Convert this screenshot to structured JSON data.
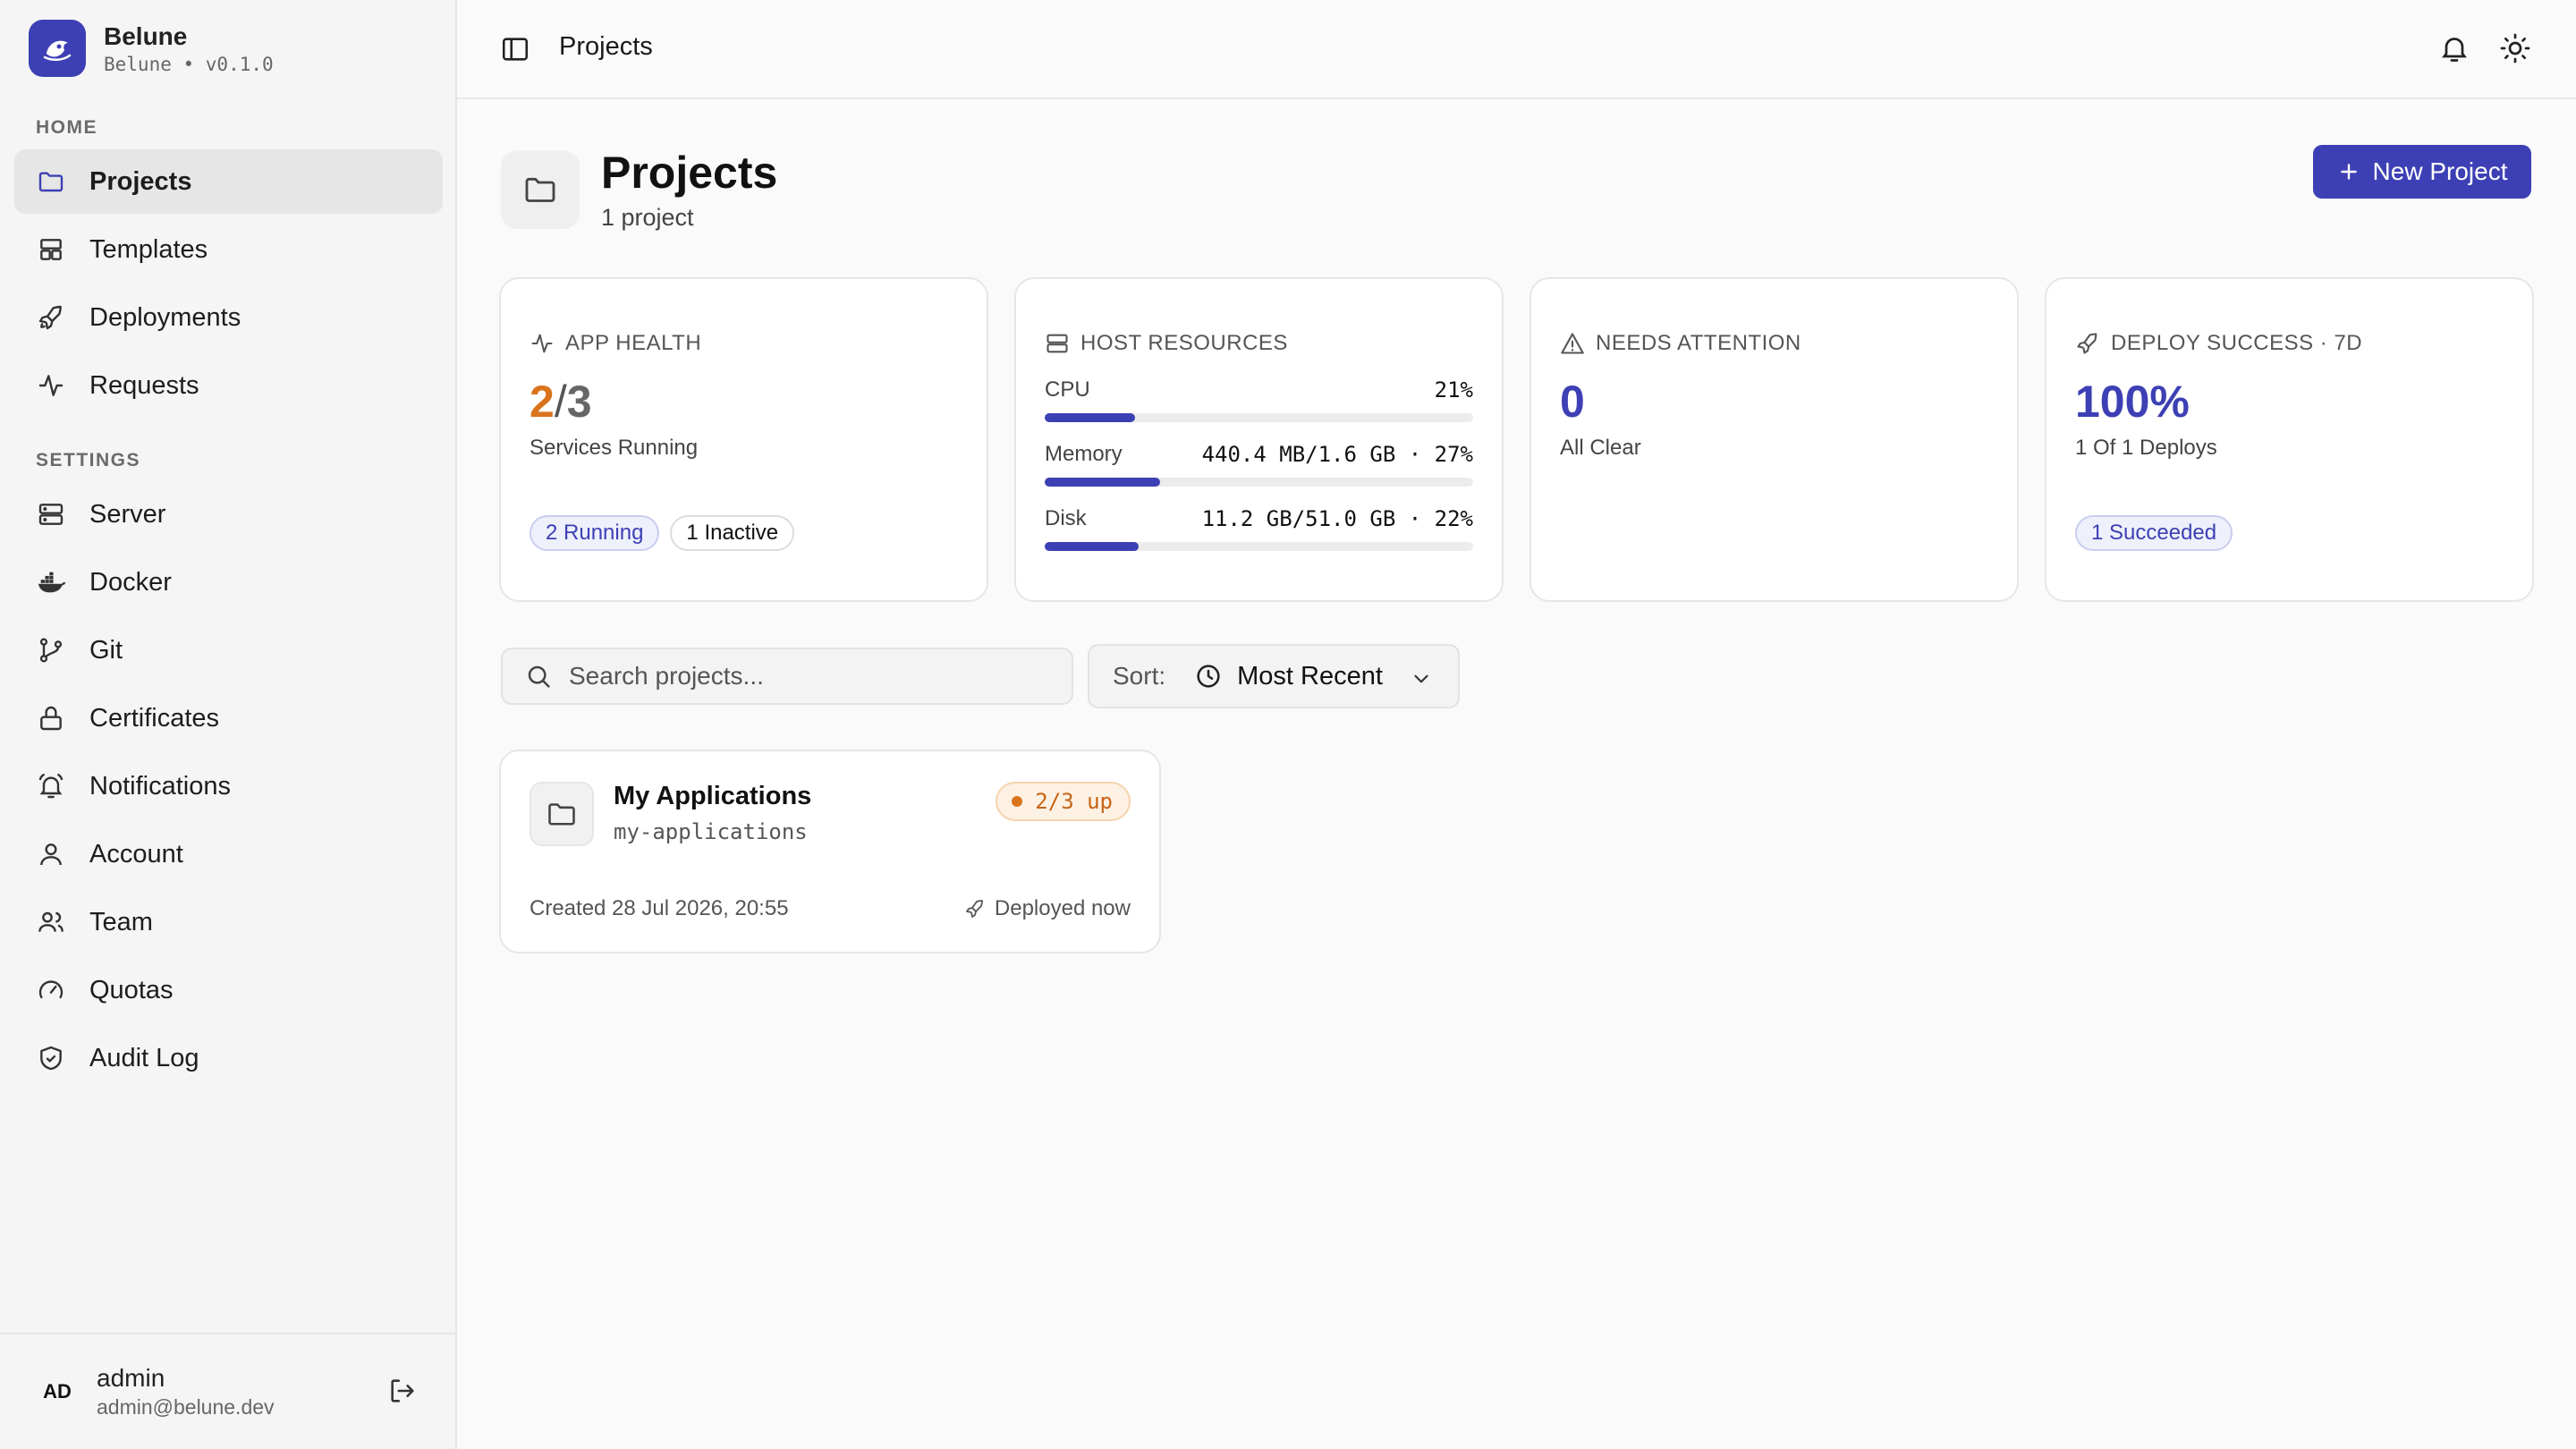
{
  "brand": {
    "name": "Belune",
    "version": "Belune • v0.1.0"
  },
  "sidebar": {
    "home_label": "HOME",
    "home_items": [
      {
        "label": "Projects",
        "icon": "folder-icon",
        "active": true
      },
      {
        "label": "Templates",
        "icon": "layout-icon"
      },
      {
        "label": "Deployments",
        "icon": "rocket-icon"
      },
      {
        "label": "Requests",
        "icon": "activity-icon"
      }
    ],
    "settings_label": "SETTINGS",
    "settings_items": [
      {
        "label": "Server",
        "icon": "server-icon"
      },
      {
        "label": "Docker",
        "icon": "docker-icon"
      },
      {
        "label": "Git",
        "icon": "git-branch-icon"
      },
      {
        "label": "Certificates",
        "icon": "lock-icon"
      },
      {
        "label": "Notifications",
        "icon": "bell-ring-icon"
      },
      {
        "label": "Account",
        "icon": "user-icon"
      },
      {
        "label": "Team",
        "icon": "users-icon"
      },
      {
        "label": "Quotas",
        "icon": "gauge-icon"
      },
      {
        "label": "Audit Log",
        "icon": "shield-check-icon"
      }
    ],
    "user": {
      "initials": "AD",
      "name": "admin",
      "email": "admin@belune.dev"
    }
  },
  "topbar": {
    "title": "Projects"
  },
  "page": {
    "title": "Projects",
    "subtitle": "1 project",
    "new_button": "New Project"
  },
  "cards": {
    "app_health": {
      "title": "APP HEALTH",
      "running": "2",
      "separator": "/",
      "total": "3",
      "sub": "Services Running",
      "pill_running": "2 Running",
      "pill_inactive": "1 Inactive"
    },
    "host_resources": {
      "title": "HOST RESOURCES",
      "rows": [
        {
          "label": "CPU",
          "value": "21%",
          "percent": 21
        },
        {
          "label": "Memory",
          "value": "440.4 MB/1.6 GB · 27%",
          "percent": 27
        },
        {
          "label": "Disk",
          "value": "11.2 GB/51.0 GB · 22%",
          "percent": 22
        }
      ]
    },
    "needs_attention": {
      "title": "NEEDS ATTENTION",
      "value": "0",
      "sub": "All Clear"
    },
    "deploy_success": {
      "title": "DEPLOY SUCCESS · 7D",
      "value": "100%",
      "sub": "1 Of 1 Deploys",
      "pill": "1 Succeeded"
    }
  },
  "search": {
    "placeholder": "Search projects..."
  },
  "sort": {
    "label": "Sort:",
    "value": "Most Recent"
  },
  "projects": [
    {
      "name": "My Applications",
      "slug": "my-applications",
      "status": "2/3 up",
      "created": "Created 28 Jul 2026, 20:55",
      "deployed": "Deployed now"
    }
  ],
  "colors": {
    "accent": "#3d40b4",
    "warning": "#d9731c",
    "sidebar_bg": "#f5f5f5",
    "page_bg": "#fafafa"
  }
}
